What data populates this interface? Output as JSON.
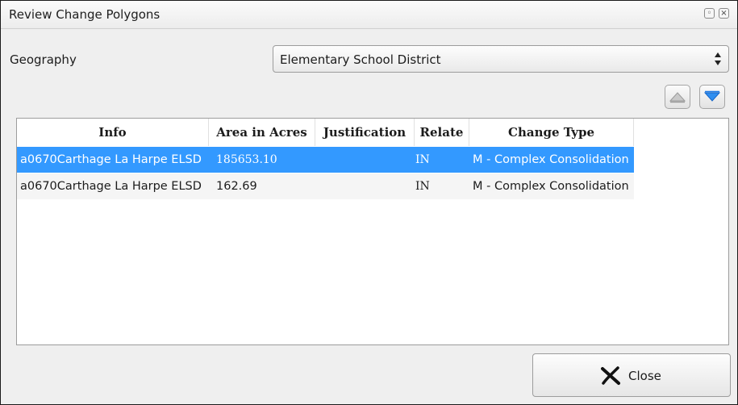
{
  "window": {
    "title": "Review Change Polygons",
    "restore_icon": "restore-icon",
    "close_icon": "close-icon"
  },
  "geography": {
    "label": "Geography",
    "selected": "Elementary School District"
  },
  "move_buttons": {
    "up_icon": "triangle-up-icon",
    "down_icon": "triangle-down-icon"
  },
  "table": {
    "columns": [
      "Info",
      "Area in Acres",
      "Justification",
      "Relate",
      "Change Type"
    ],
    "rows": [
      {
        "info": "a0670Carthage La Harpe ELSD",
        "area": "185653.10",
        "justification": "",
        "relate": "IN",
        "change_type": "M - Complex Consolidation",
        "selected": true
      },
      {
        "info": "a0670Carthage La Harpe ELSD",
        "area": "162.69",
        "justification": "",
        "relate": "IN",
        "change_type": "M - Complex Consolidation",
        "selected": false
      }
    ]
  },
  "footer": {
    "close_label": "Close",
    "close_icon": "x-icon"
  },
  "colors": {
    "selection": "#3399ff",
    "accent_blue": "#1e7ae6"
  }
}
